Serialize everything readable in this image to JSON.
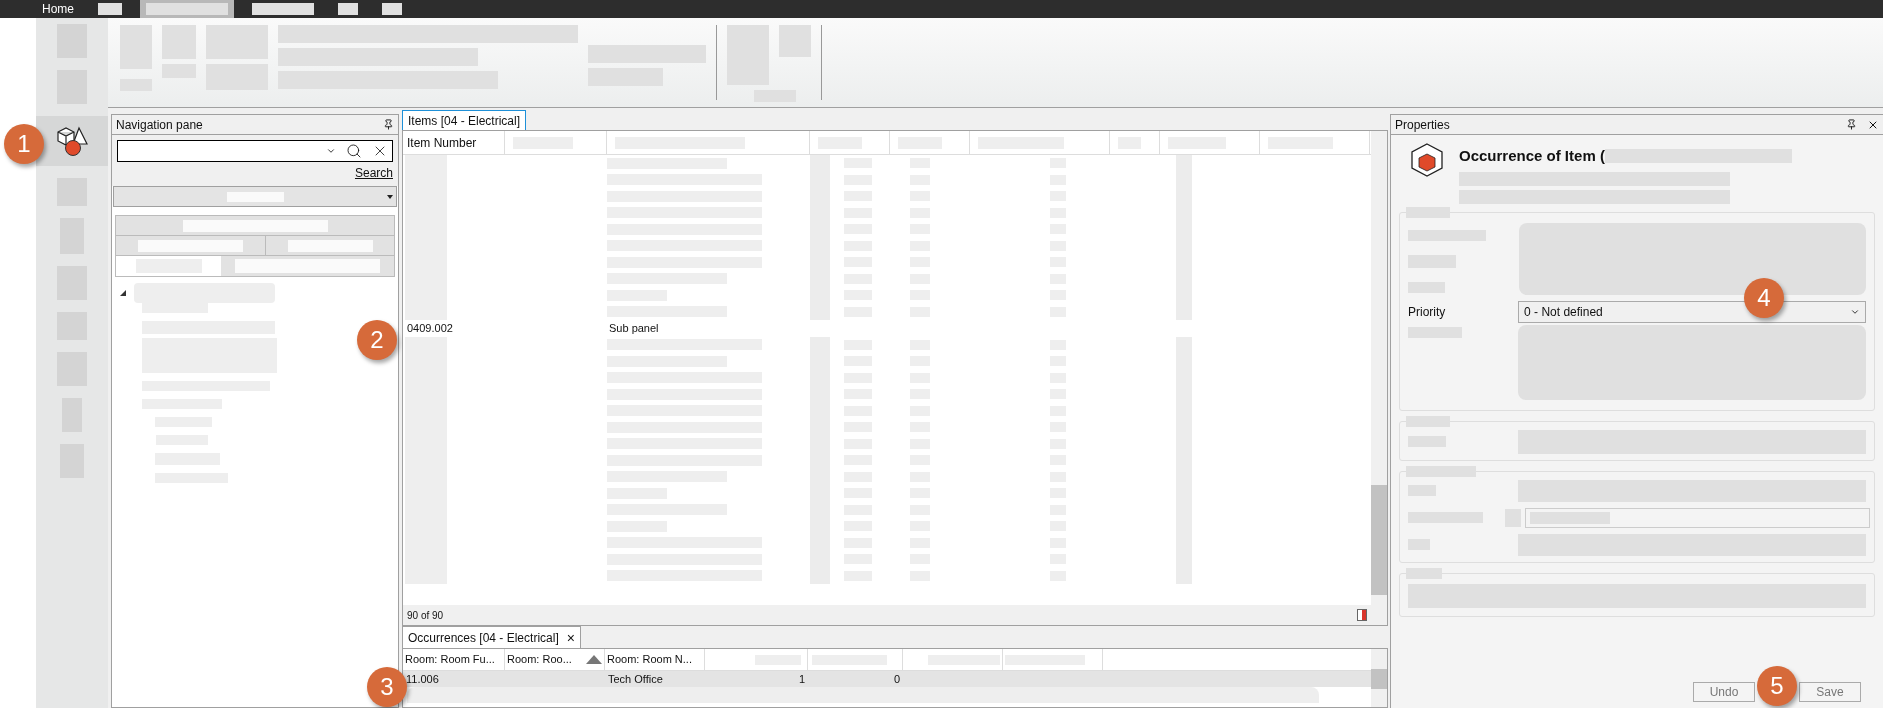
{
  "top_tabs": [
    {
      "label": "Home",
      "selected": false
    },
    {
      "kind": "redacted",
      "selected": false
    },
    {
      "kind": "redacted",
      "selected": true
    },
    {
      "kind": "redacted",
      "selected": false
    },
    {
      "kind": "redacted",
      "selected": false
    },
    {
      "kind": "redacted",
      "selected": false
    }
  ],
  "navigation_pane": {
    "title": "Navigation pane",
    "search_link": "Search"
  },
  "items_panel": {
    "tab": "Items [04 - Electrical]",
    "columns": [
      "Item Number"
    ],
    "rows": [
      {
        "kind": "redacted"
      },
      {
        "kind": "redacted"
      },
      {
        "kind": "redacted"
      },
      {
        "kind": "redacted"
      },
      {
        "kind": "redacted"
      },
      {
        "kind": "redacted"
      },
      {
        "kind": "redacted"
      },
      {
        "kind": "redacted"
      },
      {
        "kind": "redacted"
      },
      {
        "kind": "redacted"
      },
      {
        "kind": "item",
        "item_number": "0409.002",
        "description": "Sub panel"
      },
      {
        "kind": "redacted"
      },
      {
        "kind": "redacted"
      },
      {
        "kind": "redacted"
      },
      {
        "kind": "redacted"
      },
      {
        "kind": "redacted"
      },
      {
        "kind": "redacted"
      },
      {
        "kind": "redacted"
      },
      {
        "kind": "redacted"
      },
      {
        "kind": "redacted"
      },
      {
        "kind": "redacted"
      },
      {
        "kind": "redacted"
      },
      {
        "kind": "redacted"
      },
      {
        "kind": "redacted"
      },
      {
        "kind": "redacted"
      },
      {
        "kind": "redacted"
      }
    ],
    "count": "90 of 90"
  },
  "occurrences_panel": {
    "tab": "Occurrences [04 - Electrical]",
    "close": "×",
    "columns": [
      "Room: Room Fu...",
      "Room: Roo...",
      "Room: Room N..."
    ],
    "rows": [
      {
        "cells": [
          "11.006",
          "",
          "Tech Office",
          "1",
          "0"
        ],
        "selected": true
      }
    ]
  },
  "properties": {
    "title": "Properties",
    "heading": "Occurrence of Item (",
    "fields": [
      {
        "label": "Priority",
        "value": "0 - Not defined"
      }
    ],
    "buttons": [
      "Undo",
      "Save"
    ]
  },
  "annotations": [
    "1",
    "2",
    "3",
    "4",
    "5"
  ]
}
